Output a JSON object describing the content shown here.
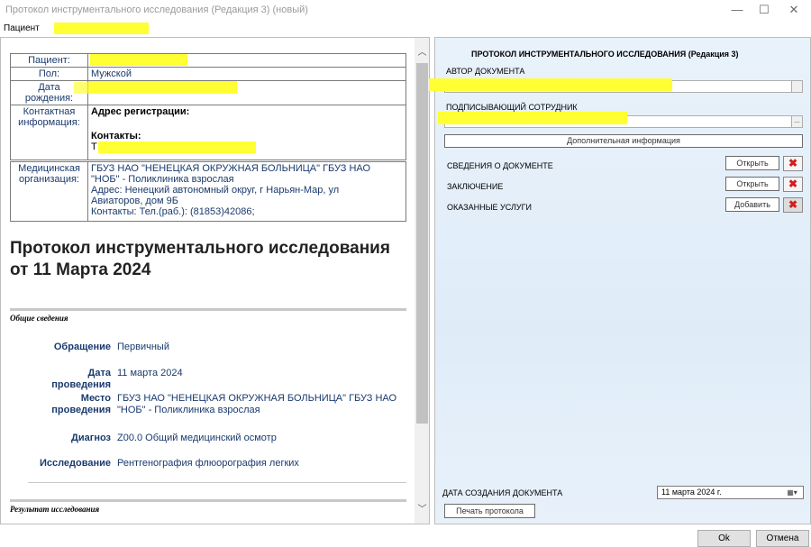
{
  "window": {
    "title": "Протокол инструментального исследования (Редакция 3) (новый)",
    "minimize": "—",
    "maximize": "☐",
    "close": "✕"
  },
  "menu": {
    "patient_label": "Пациент"
  },
  "patient_card": {
    "patient_label": "Пациент:",
    "sex_label": "Пол:",
    "sex_value": "Мужской",
    "birth_label": "Дата рождения:",
    "contacts_label_1": "Контактная",
    "contacts_label_2": "информация:",
    "reg_address_label": "Адрес регистрации:",
    "contacts_label": "Контакты:",
    "contacts_prefix": "Т"
  },
  "organization": {
    "label_1": "Медицинская",
    "label_2": "организация:",
    "line_1": "ГБУЗ НАО \"НЕНЕЦКАЯ ОКРУЖНАЯ БОЛЬНИЦА\" ГБУЗ НАО",
    "line_2": "\"НОБ\" - Поликлиника взрослая",
    "line_3": "Адрес: Ненецкий автономный округ, г Нарьян-Мар, ул",
    "line_4": "Авиаторов, дом 9Б",
    "line_5": "Контакты: Тел.(раб.): (81853)42086;"
  },
  "document": {
    "title_line_1": "Протокол инструментального исследования",
    "title_line_2": "от 11 Марта 2024",
    "section_general": "Общие сведения",
    "appeal_label": "Обращение",
    "appeal_value": "Первичный",
    "date_label_1": "Дата",
    "date_label_2": "проведения",
    "date_value": "11 марта 2024",
    "place_label_1": "Место",
    "place_label_2": "проведения",
    "place_value_1": "ГБУЗ НАО \"НЕНЕЦКАЯ ОКРУЖНАЯ БОЛЬНИЦА\" ГБУЗ НАО",
    "place_value_2": "\"НОБ\" - Поликлиника взрослая",
    "diagnosis_label": "Диагноз",
    "diagnosis_value": "Z00.0 Общий медицинский осмотр",
    "research_label": "Исследование",
    "research_value": "Рентгенография флюорография легких",
    "section_result": "Результат исследования"
  },
  "right_panel": {
    "title": "ПРОТОКОЛ ИНСТРУМЕНТАЛЬНОГО ИССЛЕДОВАНИЯ (Редакция 3)",
    "author_label": "АВТОР ДОКУМЕНТА",
    "signer_label": "ПОДПИСЫВАЮЩИЙ СОТРУДНИК",
    "ellipsis": "...",
    "extra_info_button": "Дополнительная информация",
    "rows": [
      {
        "label": "СВЕДЕНИЯ О ДОКУМЕНТЕ",
        "button": "Открыть"
      },
      {
        "label": "ЗАКЛЮЧЕНИЕ",
        "button": "Открыть"
      },
      {
        "label": "ОКАЗАННЫЕ УСЛУГИ",
        "button": "Добавить"
      }
    ],
    "delete_glyph": "✖",
    "date_created_label": "ДАТА СОЗДАНИЯ ДОКУМЕНТА",
    "date_created_value": "11  марта  2024 г.",
    "calendar_glyph": "▦▾",
    "print_button": "Печать протокола"
  },
  "footer": {
    "ok": "Ok",
    "cancel": "Отмена"
  },
  "colors": {
    "highlight": "#ffff33",
    "doc_text": "#1a3a6e",
    "delete_red": "#d21e1e"
  }
}
